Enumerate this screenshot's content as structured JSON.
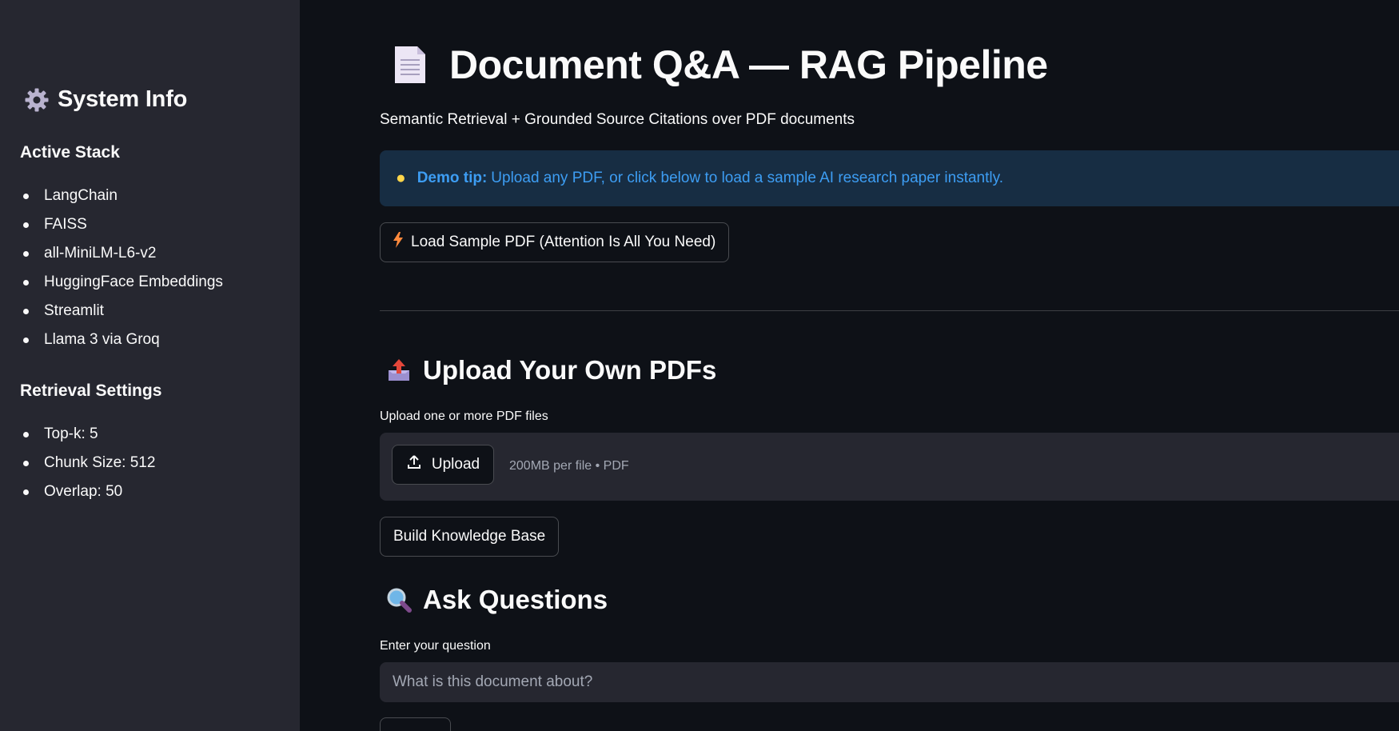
{
  "sidebar": {
    "title": "System Info",
    "title_icon": "gear-icon",
    "active_stack_heading": "Active Stack",
    "active_stack": [
      "LangChain",
      "FAISS",
      "all-MiniLM-L6-v2",
      "HuggingFace Embeddings",
      "Streamlit",
      "Llama 3 via Groq"
    ],
    "retrieval_heading": "Retrieval Settings",
    "retrieval_settings": [
      "Top-k: 5",
      "Chunk Size: 512",
      "Overlap: 50"
    ]
  },
  "header": {
    "title": "Document Q&A — RAG Pipeline",
    "title_icon": "document-icon",
    "subtitle": "Semantic Retrieval + Grounded Source Citations over PDF documents"
  },
  "tip": {
    "icon": "lightbulb-icon",
    "label": "Demo tip:",
    "text": "Upload any PDF, or click below to load a sample AI research paper instantly."
  },
  "sample_button": {
    "icon": "lightning-icon",
    "label": "Load Sample PDF (Attention Is All You Need)"
  },
  "upload_section": {
    "heading": "Upload Your Own PDFs",
    "heading_icon": "outbox-tray-icon",
    "field_label": "Upload one or more PDF files",
    "upload_button": "Upload",
    "upload_icon": "upload-icon",
    "limits": "200MB per file • PDF"
  },
  "build_button": {
    "label": "Build Knowledge Base"
  },
  "ask_section": {
    "heading": "Ask Questions",
    "heading_icon": "magnifier-icon",
    "field_label": "Enter your question",
    "placeholder": "What is this document about?",
    "value": ""
  },
  "colors": {
    "background": "#0e1117",
    "sidebar": "#262730",
    "tip_background": "#172d43",
    "tip_text": "#3d9df3",
    "text": "#fafafa"
  }
}
